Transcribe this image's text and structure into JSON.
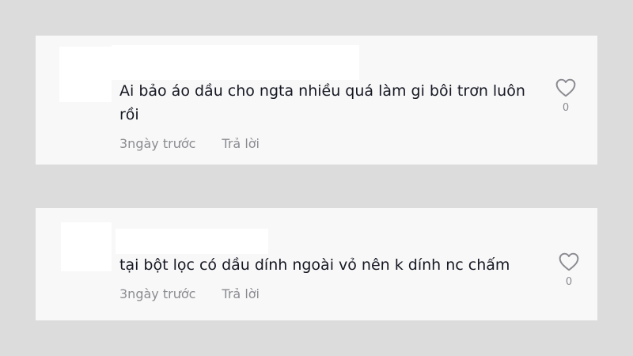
{
  "comments": [
    {
      "text": "Ai bảo áo dầu cho ngta nhiều quá làm gi bôi trơn luôn rồi",
      "time": "3ngày trước",
      "reply_label": "Trả lời",
      "like_count": "0"
    },
    {
      "text": "tại bột lọc có dầu dính ngoài vỏ nên k dính nc chấm",
      "time": "3ngày trước",
      "reply_label": "Trả lời",
      "like_count": "0"
    }
  ],
  "icons": {
    "like": "heart-outline-icon"
  },
  "colors": {
    "background": "#dcdcdc",
    "card": "#f8f8f8",
    "text": "#161823",
    "muted": "#8a8b91"
  }
}
